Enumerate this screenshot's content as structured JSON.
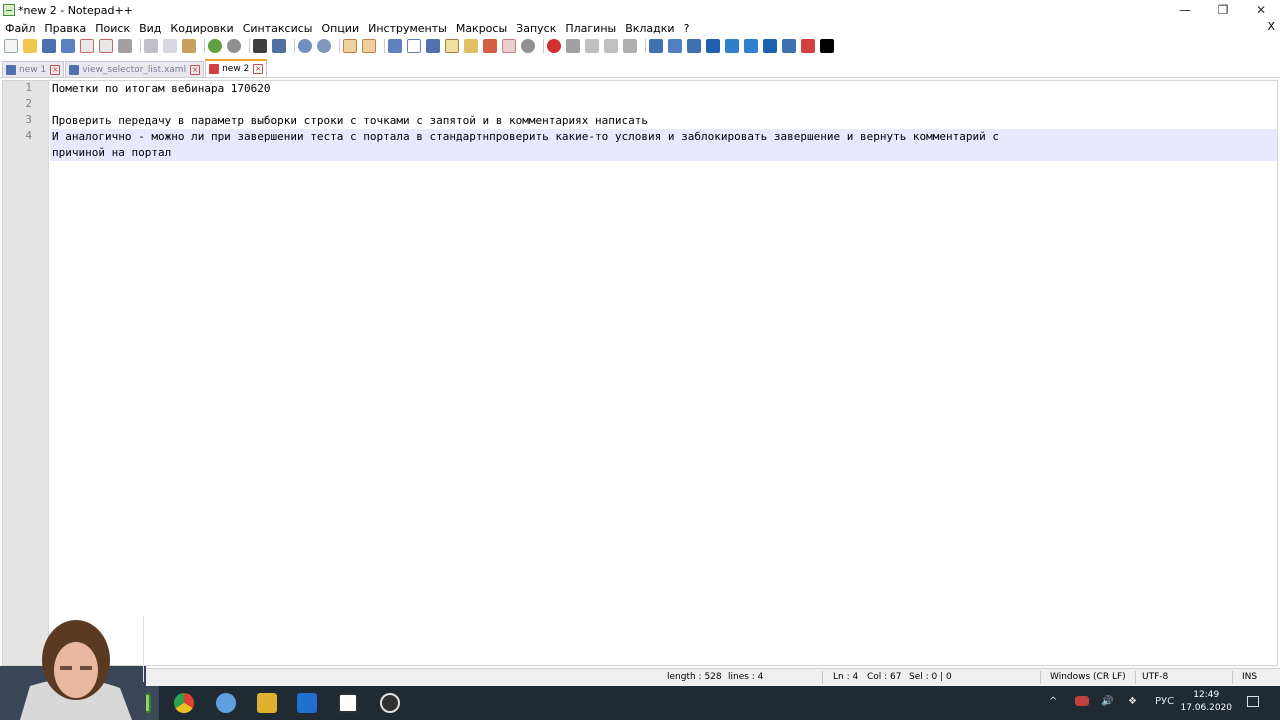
{
  "window": {
    "title": "*new 2 - Notepad++",
    "minimize": "—",
    "maximize": "❐",
    "close": "✕"
  },
  "menu": {
    "items": [
      "Файл",
      "Правка",
      "Поиск",
      "Вид",
      "Кодировки",
      "Синтаксисы",
      "Опции",
      "Инструменты",
      "Макросы",
      "Запуск",
      "Плагины",
      "Вкладки",
      "?"
    ],
    "close_doc": "X"
  },
  "tabs": [
    {
      "label": "new 1",
      "active": false
    },
    {
      "label": "view_selector_list.xaml",
      "active": false
    },
    {
      "label": "new 2",
      "active": true
    }
  ],
  "editor": {
    "lines": [
      {
        "no": "1",
        "text": "Пометки по итогам вебинара 170620"
      },
      {
        "no": "2",
        "text": ""
      },
      {
        "no": "3",
        "text": "Проверить передачу в параметр выборки строки с точками с запятой и в комментариях написать"
      },
      {
        "no": "4",
        "text": "И аналогично - можно ли при завершении теста с портала в стандартнпроверить какие-то условия и заблокировать завершение и вернуть комментарий с"
      },
      {
        "no": "",
        "text": "причиной на портал"
      }
    ]
  },
  "status": {
    "length": "length : 528",
    "lines": "lines : 4",
    "ln": "Ln : 4",
    "col": "Col : 67",
    "sel": "Sel : 0 | 0",
    "eol": "Windows (CR LF)",
    "encoding": "UTF-8",
    "mode": "INS"
  },
  "taskbar": {
    "lang": "РУС",
    "time": "12:49",
    "date": "17.06.2020"
  },
  "colors": {
    "accent_tab": "#f0a030",
    "current_line": "#e8e8ff",
    "gutter": "#e4e4e4",
    "taskbar": "#1f2a33"
  }
}
